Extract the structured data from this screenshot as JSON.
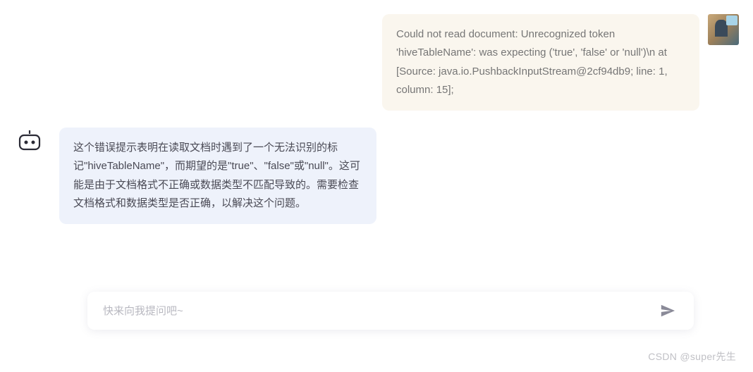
{
  "messages": {
    "user": {
      "text": "Could not read document: Unrecognized token 'hiveTableName': was expecting ('true', 'false' or 'null')\\n at [Source: java.io.PushbackInputStream@2cf94db9; line: 1, column: 15];"
    },
    "bot": {
      "text": "这个错误提示表明在读取文档时遇到了一个无法识别的标记\"hiveTableName\"，而期望的是\"true\"、\"false\"或\"null\"。这可能是由于文档格式不正确或数据类型不匹配导致的。需要检查文档格式和数据类型是否正确，以解决这个问题。"
    }
  },
  "input": {
    "placeholder": "快来向我提问吧~",
    "value": ""
  },
  "watermark": "CSDN @super先生",
  "icons": {
    "bot": "bot-icon",
    "send": "send-icon"
  }
}
